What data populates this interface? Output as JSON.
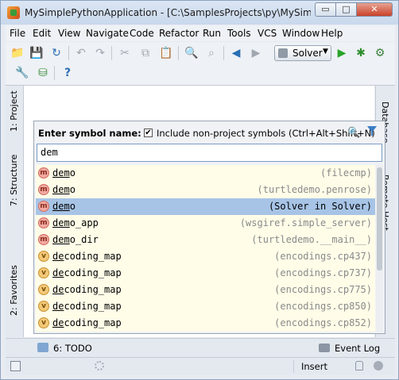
{
  "window": {
    "title": "MySimplePythonApplication - [C:\\SamplesProjects\\py\\MySimpleP...",
    "minimize_glyph": "▭",
    "maximize_glyph": "□",
    "close_glyph": "✕"
  },
  "menu": [
    "File",
    "Edit",
    "View",
    "Navigate",
    "Code",
    "Refactor",
    "Run",
    "Tools",
    "VCS",
    "Window",
    "Help"
  ],
  "toolbar": {
    "run_config": "Solver",
    "dropdown_glyph": "▼",
    "icons": {
      "open": "📁",
      "save": "💾",
      "sync": "↻",
      "undo": "↶",
      "redo": "↷",
      "cut": "✂",
      "copy": "⧉",
      "paste": "📋",
      "find": "🔍",
      "replace": "⌕",
      "back": "◀",
      "forward": "▶",
      "run": "▶",
      "debug": "✱",
      "coverage": "⚙",
      "settings": "🔧",
      "structure": "⛁",
      "help": "?"
    }
  },
  "left_tabs": [
    "1: Project",
    "7: Structure",
    "2: Favorites"
  ],
  "right_tabs": [
    "Database",
    "Remote Host"
  ],
  "popup": {
    "label": "Enter symbol name:",
    "checkbox_checked": "✔",
    "checkbox_label": "Include non-project symbols (Ctrl+Alt+Shift+N)",
    "search_value": "dem",
    "search_glyph": "🔍"
  },
  "results": [
    {
      "kind": "m",
      "match": "dem",
      "rest": "o",
      "location": "(filecmp)",
      "selected": false
    },
    {
      "kind": "m",
      "match": "dem",
      "rest": "o",
      "location": "(turtledemo.penrose)",
      "selected": false
    },
    {
      "kind": "m",
      "match": "dem",
      "rest": "o",
      "location": "(Solver in Solver)",
      "selected": true
    },
    {
      "kind": "m",
      "match": "dem",
      "rest": "o_app",
      "location": "(wsgiref.simple_server)",
      "selected": false
    },
    {
      "kind": "m",
      "match": "dem",
      "rest": "o_dir",
      "location": "(turtledemo.__main__)",
      "selected": false
    },
    {
      "kind": "v",
      "match": "de",
      "rest": "coding_map",
      "location": "(encodings.cp437)",
      "selected": false
    },
    {
      "kind": "v",
      "match": "de",
      "rest": "coding_map",
      "location": "(encodings.cp737)",
      "selected": false
    },
    {
      "kind": "v",
      "match": "de",
      "rest": "coding_map",
      "location": "(encodings.cp775)",
      "selected": false
    },
    {
      "kind": "v",
      "match": "de",
      "rest": "coding_map",
      "location": "(encodings.cp850)",
      "selected": false
    },
    {
      "kind": "v",
      "match": "de",
      "rest": "coding_map",
      "location": "(encodings.cp852)",
      "selected": false
    }
  ],
  "bottom": {
    "todo": "6: TODO",
    "event_log": "Event Log"
  },
  "status": {
    "insert": "Insert"
  },
  "colors": {
    "selection": "#a7c4e6",
    "row_background": "#fffce8",
    "run_green": "#28a428"
  }
}
